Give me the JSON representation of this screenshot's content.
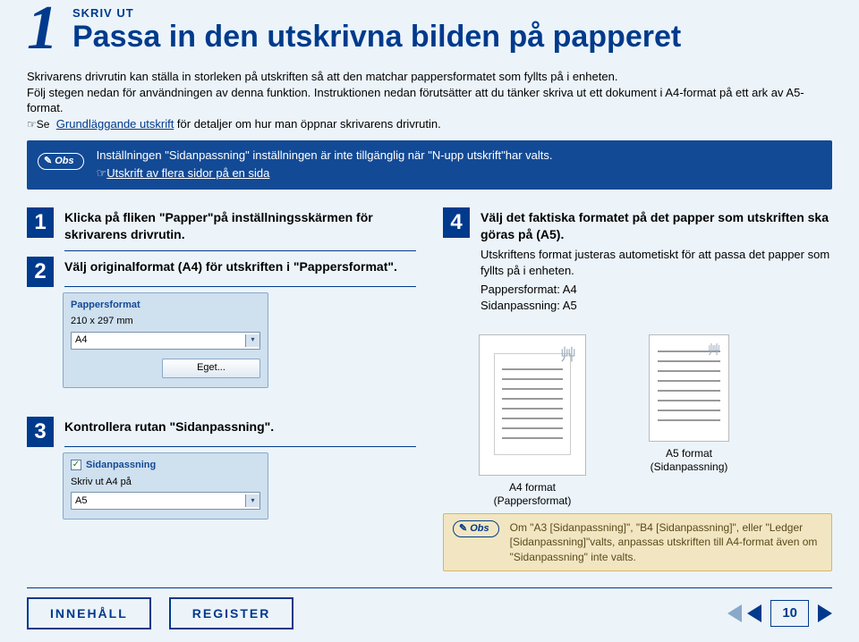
{
  "header": {
    "big_number": "1",
    "small_title": "SKRIV UT",
    "main_title": "Passa in den utskrivna bilden på papperet"
  },
  "intro": {
    "p1": "Skrivarens drivrutin kan ställa in storleken på utskriften så att den matchar pappersformatet som fyllts på i enheten.",
    "p2": "Följ stegen nedan för användningen av denna funktion. Instruktionen nedan förutsätter att du tänker skriva ut ett dokument i A4-format på ett ark av A5-format.",
    "link1_prefix": "☞Se ",
    "link1": "Grundläggande utskrift",
    "link1_suffix": " för detaljer om hur man öppnar skrivarens drivrutin."
  },
  "callout": {
    "obs_label": "Obs",
    "line1": "Inställningen \"Sidanpassning\" inställningen är inte tillgänglig när \"N-upp utskrift\"har valts.",
    "link_prefix": "☞",
    "link": "Utskrift av flera sidor på en sida"
  },
  "steps": {
    "s1": {
      "num": "1",
      "title": "Klicka på fliken \"Papper\"på inställningsskärmen för skrivarens drivrutin."
    },
    "s2": {
      "num": "2",
      "title": "Välj originalformat (A4) för utskriften i \"Pappersformat\"."
    },
    "s3": {
      "num": "3",
      "title": "Kontrollera rutan \"Sidanpassning\"."
    },
    "s4": {
      "num": "4",
      "title": "Välj det faktiska formatet på det papper som utskriften ska göras på (A5).",
      "detail1": "Utskriftens format justeras autometiskt för att passa det papper som fyllts på i enheten.",
      "detail2": "Pappersformat: A4",
      "detail3": "Sidanpassning: A5"
    }
  },
  "ui_a": {
    "group_label": "Pappersformat",
    "dims": "210 x 297 mm",
    "select_value": "A4",
    "button": "Eget..."
  },
  "ui_b": {
    "group_label": "Sidanpassning",
    "line": "Skriv ut A4 på",
    "select_value": "A5"
  },
  "papers": {
    "a4_cap1": "A4 format",
    "a4_cap2": "(Pappersformat)",
    "a5_cap1": "A5 format",
    "a5_cap2": "(Sidanpassning)"
  },
  "note": {
    "obs_label": "Obs",
    "text": "Om \"A3 [Sidanpassning]\", \"B4 [Sidanpassning]\", eller \"Ledger [Sidanpassning]\"valts, anpassas utskriften till A4-format även om \"Sidanpassning\" inte valts."
  },
  "footer": {
    "btn1": "INNEHÅLL",
    "btn2": "REGISTER",
    "page": "10"
  }
}
